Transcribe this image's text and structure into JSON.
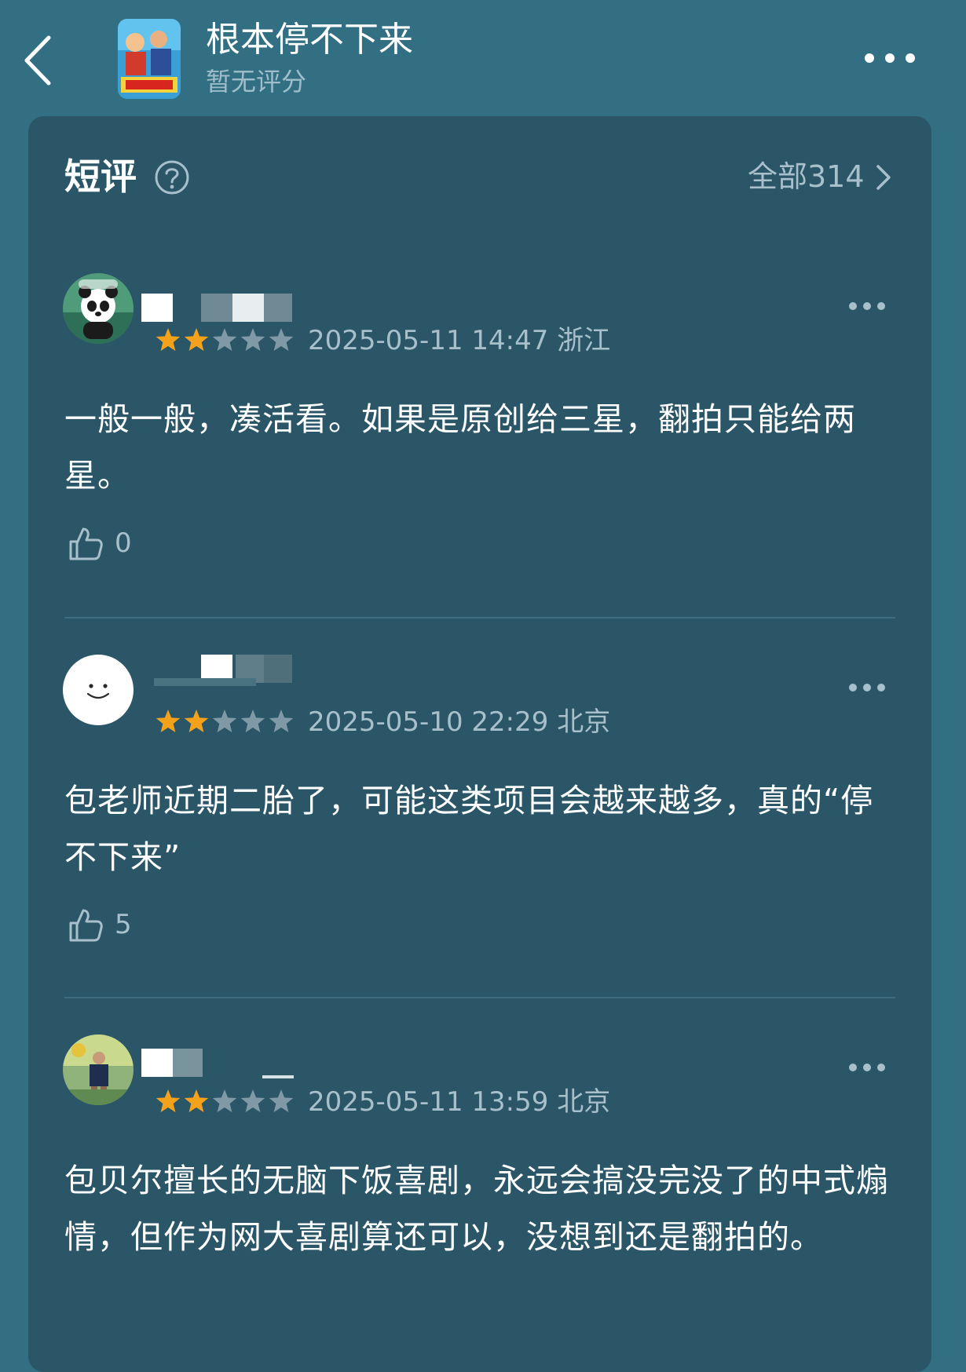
{
  "header": {
    "title": "根本停不下来",
    "subtitle": "暂无评分"
  },
  "section": {
    "title": "短评",
    "all_link": "全部314"
  },
  "reviews": [
    {
      "username": "",
      "rating": 2,
      "rating_max": 5,
      "datetime": "2025-05-11 14:47",
      "location": "浙江",
      "text": "一般一般，凑活看。如果是原创给三星，翻拍只能给两星。",
      "likes": "0",
      "avatar_type": "panda-avatar"
    },
    {
      "username": "",
      "rating": 2,
      "rating_max": 5,
      "datetime": "2025-05-10 22:29",
      "location": "北京",
      "text": "包老师近期二胎了，可能这类项目会越来越多，真的“停不下来”",
      "likes": "5",
      "avatar_type": "smiley-avatar"
    },
    {
      "username": "",
      "rating": 2,
      "rating_max": 5,
      "datetime": "2025-05-11 13:59",
      "location": "北京",
      "text": "包贝尔擅长的无脑下饭喜剧，永远会搞没完没了的中式煽情，但作为网大喜剧算还可以，没想到还是翻拍的。",
      "likes": "",
      "avatar_type": "photo-avatar"
    }
  ],
  "icons": {
    "back": "chevron-left-icon",
    "more": "more-dots-icon",
    "help": "question-circle-icon",
    "chevron": "chevron-right-icon",
    "like": "thumbs-up-icon",
    "star": "star-icon"
  },
  "colors": {
    "background": "#336f82",
    "card": "#2a5668",
    "star_filled": "#f4a21c",
    "star_empty": "#7f9aa6",
    "muted_text": "#a8c0cb"
  }
}
